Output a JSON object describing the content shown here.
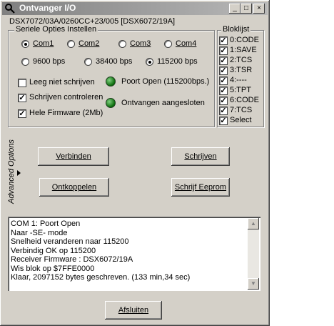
{
  "window": {
    "title": "Ontvanger I/O",
    "minimize": "_",
    "maximize": "□",
    "close": "×"
  },
  "info_line": "DSX7072/03A/0260CC+23/005 [DSX6072/19A]",
  "serial": {
    "legend": "Seriele Opties Instellen",
    "ports": [
      {
        "label": "Com1",
        "selected": true
      },
      {
        "label": "Com2",
        "selected": false
      },
      {
        "label": "Com3",
        "selected": false
      },
      {
        "label": "Com4",
        "selected": false
      }
    ],
    "speeds": [
      {
        "label": "9600 bps",
        "selected": false
      },
      {
        "label": "38400 bps",
        "selected": false
      },
      {
        "label": "115200 bps",
        "selected": true
      }
    ],
    "options": [
      {
        "label": "Leeg niet schrijven",
        "checked": false
      },
      {
        "label": "Schrijven controleren",
        "checked": true
      },
      {
        "label": "Hele Firmware (2Mb)",
        "checked": true
      }
    ],
    "status": [
      {
        "label": "Poort Open (115200bps.)"
      },
      {
        "label": "Ontvangen aangesloten"
      }
    ]
  },
  "bloklijst": {
    "legend": "Bloklijst",
    "items": [
      {
        "label": "0:CODE",
        "checked": true
      },
      {
        "label": "1:SAVE",
        "checked": true
      },
      {
        "label": "2:TCS",
        "checked": true
      },
      {
        "label": "3:TSR",
        "checked": true
      },
      {
        "label": "4:----",
        "checked": true
      },
      {
        "label": "5:TPT",
        "checked": true
      },
      {
        "label": "6:CODE",
        "checked": true
      },
      {
        "label": "7:TCS",
        "checked": true
      },
      {
        "label": "Select",
        "checked": true
      }
    ]
  },
  "advanced": {
    "label": "Advanced Options"
  },
  "buttons": {
    "verbinden": "Verbinden",
    "ontkoppelen": "Ontkoppelen",
    "schrijven": "Schrijven",
    "schrijf_eeprom": "Schrijf Eeprom",
    "afsluiten": "Afsluiten"
  },
  "log": [
    "COM 1: Poort Open",
    "Naar -SE- mode",
    "Snelheid veranderen naar 115200",
    "Verbindig OK op 115200",
    "Receiver Firmware : DSX6072/19A",
    "Wis blok op $7FFE0000",
    "Klaar, 2097152 bytes geschreven. (133 min,34 sec)"
  ]
}
